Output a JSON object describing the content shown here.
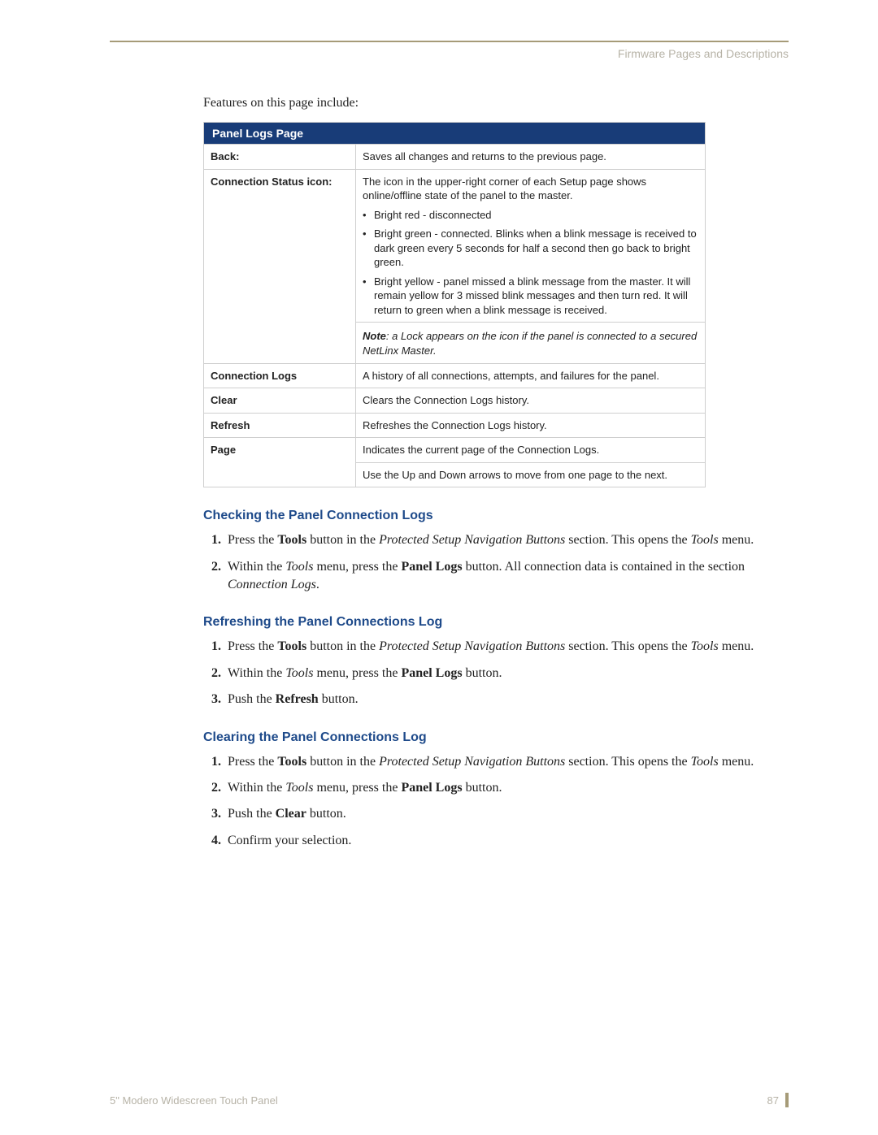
{
  "header": {
    "section_title": "Firmware Pages and Descriptions"
  },
  "intro": "Features on this page include:",
  "table": {
    "title": "Panel Logs Page",
    "rows": [
      {
        "label": "Back:",
        "text": "Saves all changes and returns to the previous page."
      },
      {
        "label": "Connection Status icon:",
        "lead": "The icon in the upper-right corner of each Setup page shows online/offline state of the panel to the master.",
        "bullets": [
          "Bright red - disconnected",
          "Bright green - connected. Blinks when a blink message is received to dark green every 5 seconds for half a second then go back to bright green.",
          "Bright yellow - panel missed a blink message from the master. It will remain yellow for 3 missed blink messages and then turn red. It will return to green when a blink message is received."
        ],
        "note_label": "Note",
        "note_text": ": a Lock appears on the icon if the panel is connected to a secured NetLinx Master."
      },
      {
        "label": "Connection Logs",
        "text": "A history of all connections, attempts, and failures for the panel."
      },
      {
        "label": "Clear",
        "text": "Clears the Connection Logs history."
      },
      {
        "label": "Refresh",
        "text": "Refreshes the Connection Logs history."
      },
      {
        "label": "Page",
        "line1": "Indicates the current page of the Connection Logs.",
        "line2": "Use the Up and Down arrows to move from one page to the next."
      }
    ]
  },
  "sections": [
    {
      "heading": "Checking the Panel Connection Logs",
      "steps": [
        [
          {
            "t": "Press the "
          },
          {
            "t": "Tools",
            "b": true
          },
          {
            "t": " button in the "
          },
          {
            "t": "Protected Setup Navigation Buttons",
            "i": true
          },
          {
            "t": " section. This opens the "
          },
          {
            "t": "Tools",
            "i": true
          },
          {
            "t": " menu."
          }
        ],
        [
          {
            "t": "Within the "
          },
          {
            "t": "Tools",
            "i": true
          },
          {
            "t": " menu, press the "
          },
          {
            "t": "Panel Logs",
            "b": true
          },
          {
            "t": " button. All connection data is contained in the section "
          },
          {
            "t": "Connection Logs",
            "i": true
          },
          {
            "t": "."
          }
        ]
      ]
    },
    {
      "heading": "Refreshing the Panel Connections Log",
      "steps": [
        [
          {
            "t": "Press the "
          },
          {
            "t": "Tools",
            "b": true
          },
          {
            "t": " button in the "
          },
          {
            "t": "Protected Setup Navigation Buttons",
            "i": true
          },
          {
            "t": " section. This opens the "
          },
          {
            "t": "Tools",
            "i": true
          },
          {
            "t": " menu."
          }
        ],
        [
          {
            "t": "Within the "
          },
          {
            "t": "Tools",
            "i": true
          },
          {
            "t": " menu, press the "
          },
          {
            "t": "Panel Logs",
            "b": true
          },
          {
            "t": " button."
          }
        ],
        [
          {
            "t": "Push the "
          },
          {
            "t": "Refresh",
            "b": true
          },
          {
            "t": " button."
          }
        ]
      ]
    },
    {
      "heading": "Clearing the Panel Connections Log",
      "steps": [
        [
          {
            "t": "Press the "
          },
          {
            "t": "Tools",
            "b": true
          },
          {
            "t": " button in the "
          },
          {
            "t": "Protected Setup Navigation Buttons",
            "i": true
          },
          {
            "t": " section. This opens the "
          },
          {
            "t": "Tools",
            "i": true
          },
          {
            "t": " menu."
          }
        ],
        [
          {
            "t": "Within the "
          },
          {
            "t": "Tools",
            "i": true
          },
          {
            "t": " menu, press the "
          },
          {
            "t": "Panel Logs",
            "b": true
          },
          {
            "t": " button."
          }
        ],
        [
          {
            "t": "Push the "
          },
          {
            "t": "Clear",
            "b": true
          },
          {
            "t": " button."
          }
        ],
        [
          {
            "t": "Confirm your selection."
          }
        ]
      ]
    }
  ],
  "footer": {
    "left": "5\" Modero Widescreen Touch Panel",
    "page": "87"
  }
}
